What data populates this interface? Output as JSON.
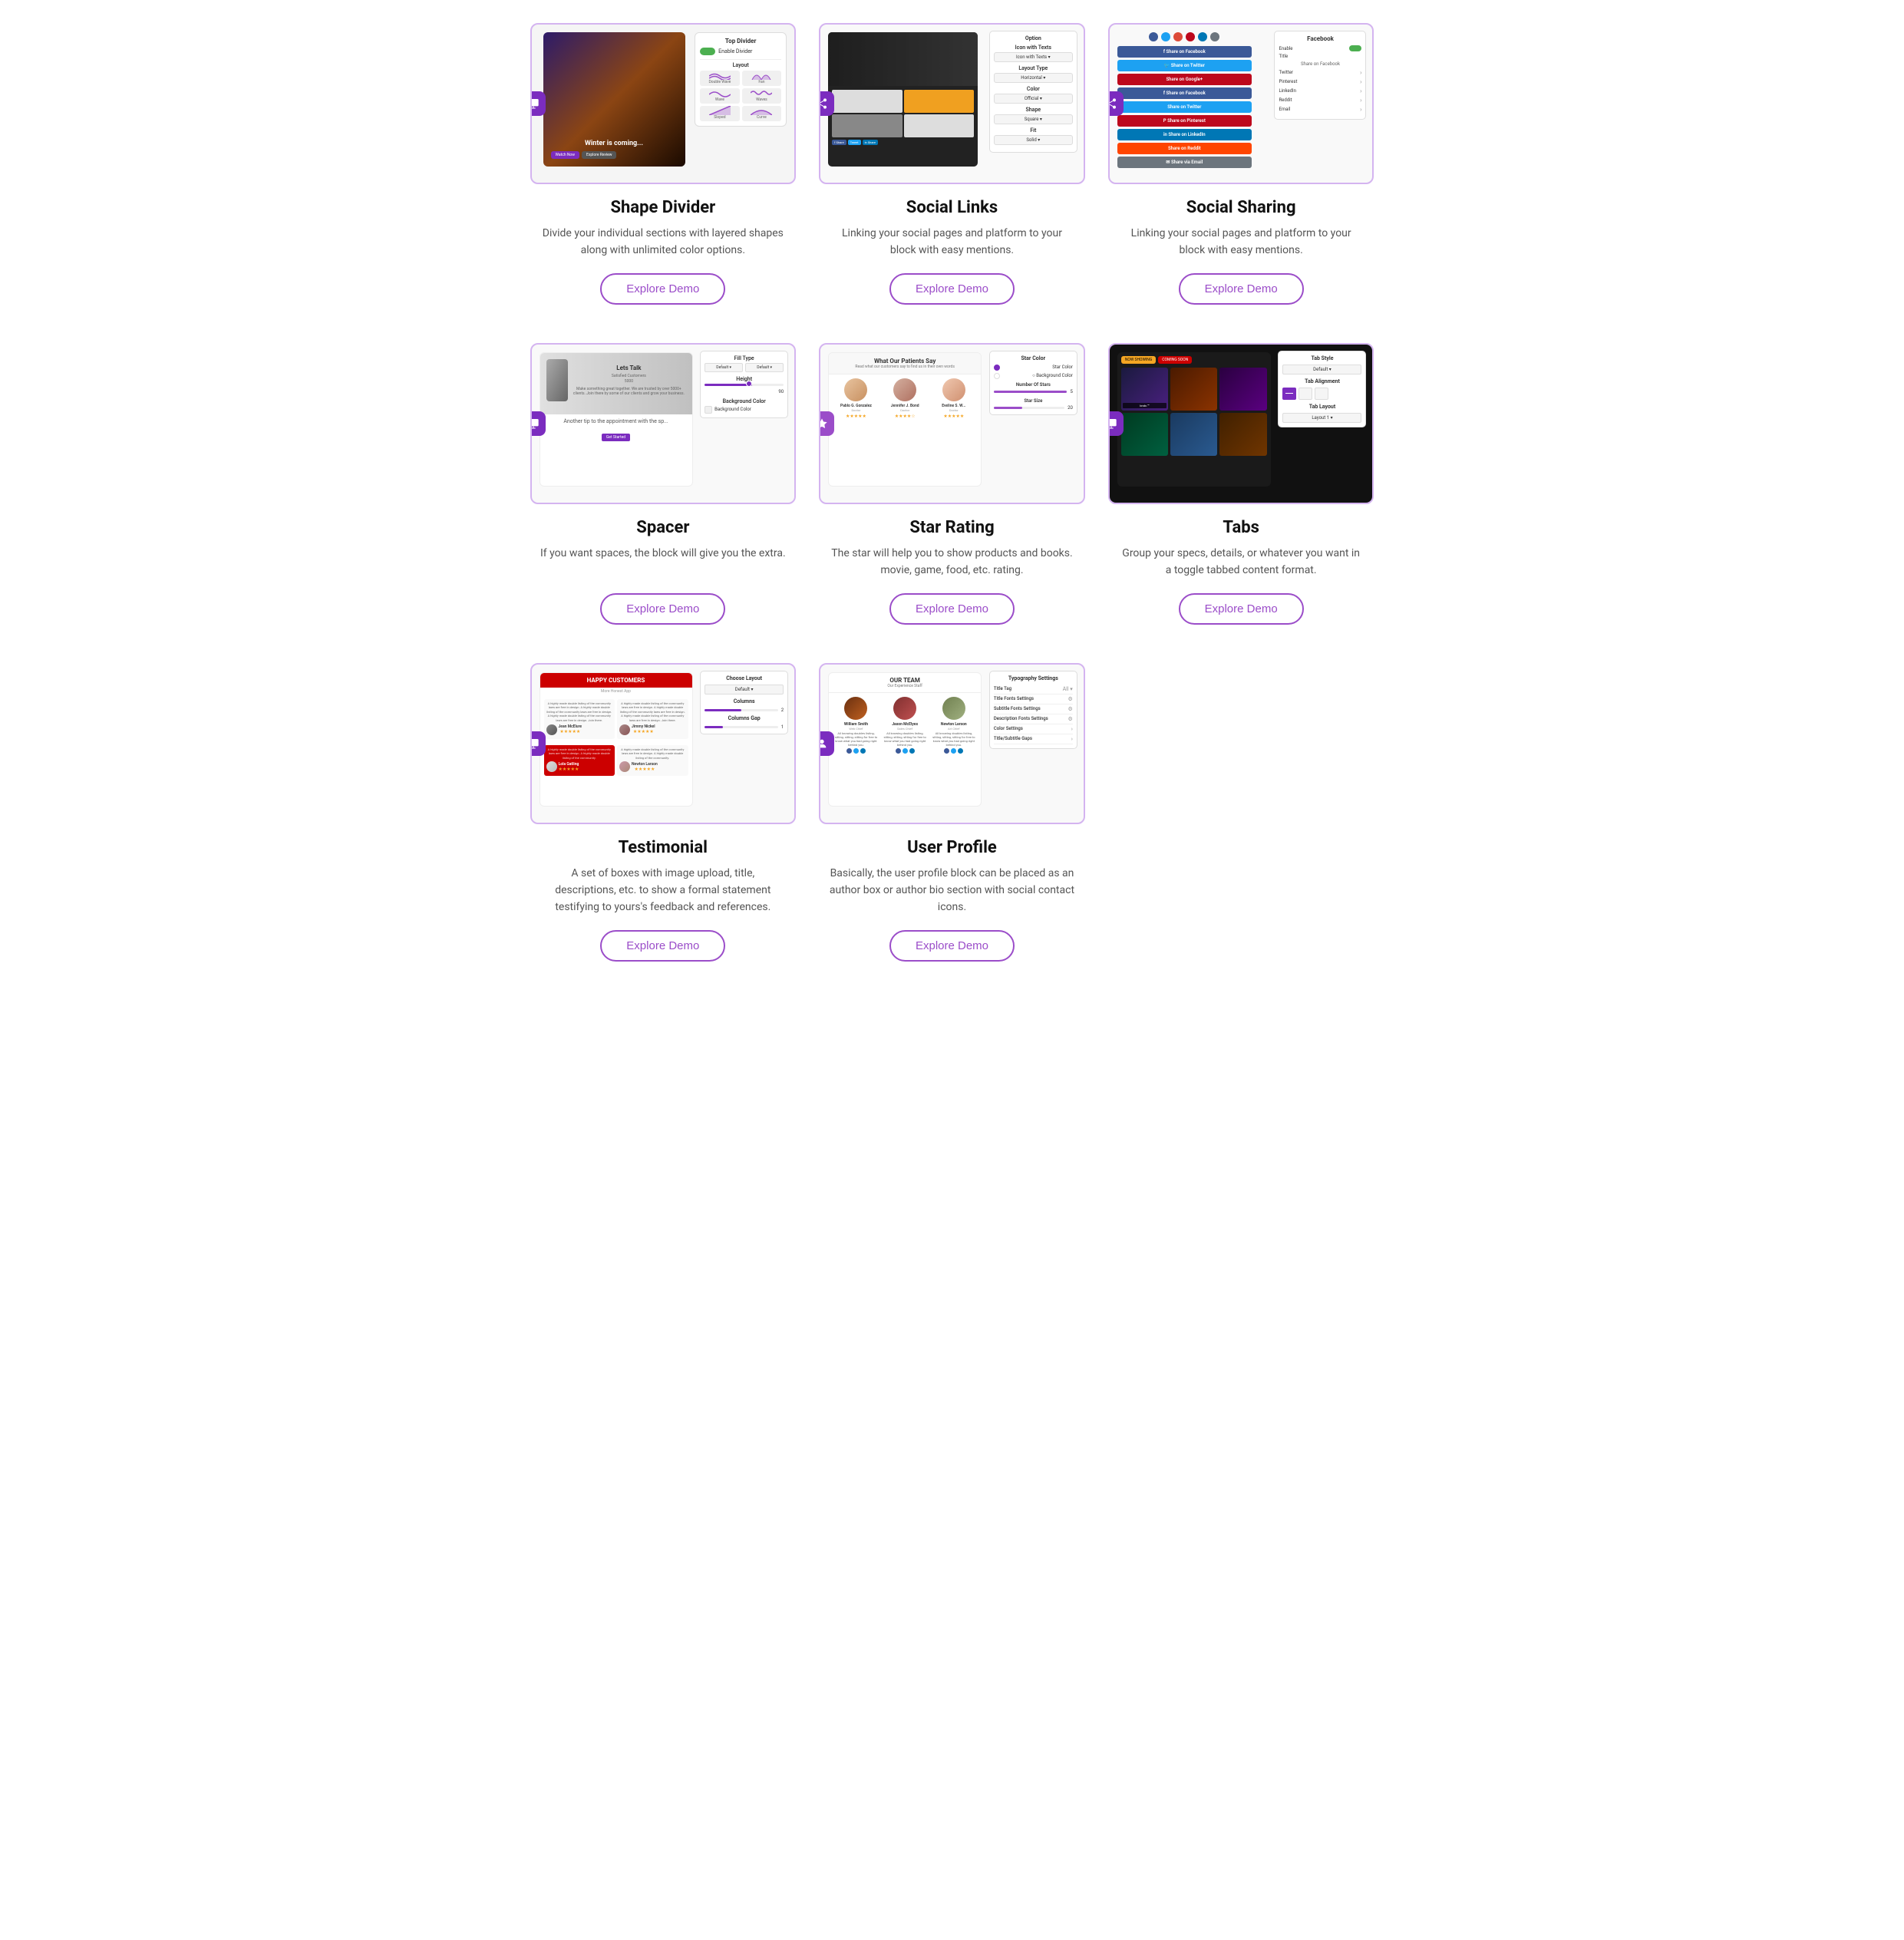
{
  "cards": [
    {
      "id": "shape-divider",
      "title": "Shape Divider",
      "description": "Divide your individual sections with layered shapes along with unlimited color options.",
      "button_label": "Explore Demo",
      "has_button": true,
      "icon_type": "monitor"
    },
    {
      "id": "social-links",
      "title": "Social Links",
      "description": "Linking your social pages and platform to your block with easy mentions.",
      "button_label": "Explore Demo",
      "has_button": true,
      "icon_type": "share"
    },
    {
      "id": "social-sharing",
      "title": "Social Sharing",
      "description": "Linking your social pages and platform to your block with easy mentions.",
      "button_label": "Explore Demo",
      "has_button": true,
      "icon_type": "share"
    },
    {
      "id": "spacer",
      "title": "Spacer",
      "description": "If you want spaces, the block will give you the extra.",
      "button_label": "Explore Demo",
      "has_button": true,
      "icon_type": "monitor"
    },
    {
      "id": "star-rating",
      "title": "Star Rating",
      "description": "The star will help you to show products and books. movie, game, food, etc. rating.",
      "button_label": "Explore Demo",
      "has_button": true,
      "icon_type": "star"
    },
    {
      "id": "tabs",
      "title": "Tabs",
      "description": "Group your specs, details, or whatever you want in a toggle tabbed content format.",
      "button_label": "Explore Demo",
      "has_button": true,
      "icon_type": "monitor"
    },
    {
      "id": "testimonial",
      "title": "Testimonial",
      "description": "A set of boxes with image upload, title, descriptions, etc. to show a formal statement testifying to yours's feedback and references.",
      "button_label": "Explore Demo",
      "has_button": true,
      "icon_type": "monitor"
    },
    {
      "id": "user-profile",
      "title": "User Profile",
      "description": "Basically, the user profile block can be placed as an author box or author bio section with social contact icons.",
      "button_label": "Explore Demo",
      "has_button": true,
      "icon_type": "person"
    }
  ],
  "panel": {
    "top_divider": "Top Divider",
    "enable_divider": "Enable Divider",
    "layout": "Layout",
    "double_wave": "Double Wave",
    "fan": "Fan",
    "wave": "Wave",
    "waves": "Waves",
    "sloped": "Sloped",
    "curve": "Curve"
  },
  "social_links_panel": {
    "option": "Option",
    "layout_type": "Layout Type",
    "horizontal": "Horizontal",
    "color": "Color",
    "official": "Official",
    "shape": "Shape",
    "square": "Square",
    "fit": "Fit",
    "solid": "Solid"
  },
  "social_sharing_panel": {
    "facebook_label": "Facebook",
    "twitter_label": "Twitter",
    "pinterest_label": "Pinterest",
    "linkedin_label": "LinkedIn",
    "reddit_label": "Reddit",
    "email_label": "Email",
    "enable": "Enable",
    "title": "Title"
  },
  "colors": {
    "accent": "#9b4dc9",
    "accent_dark": "#7b2cbf",
    "facebook": "#3b5998",
    "twitter": "#1da1f2",
    "pinterest": "#bd081c",
    "linkedin": "#0077b5",
    "reddit": "#ff4500",
    "email": "#6c757d",
    "google": "#dd4b39",
    "star": "#f5a623"
  }
}
